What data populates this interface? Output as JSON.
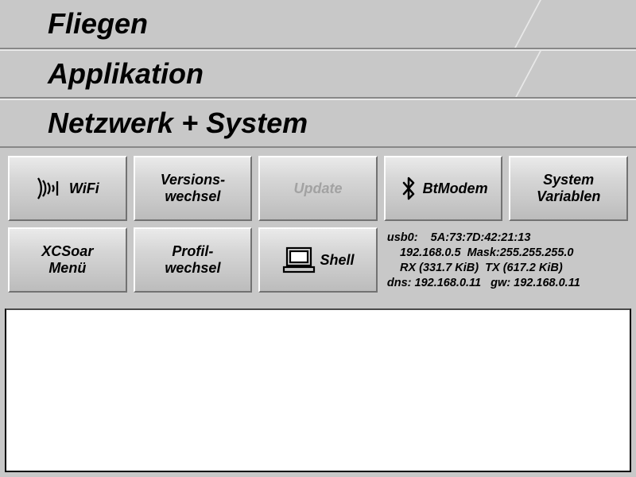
{
  "headers": {
    "fliegen": "Fliegen",
    "applikation": "Applikation",
    "netzwerk": "Netzwerk + System"
  },
  "buttons": {
    "wifi": "WiFi",
    "version_switch": "Versions-\nwechsel",
    "update": "Update",
    "btmodem": "BtModem",
    "sysvars": "System\nVariablen",
    "xcsoar_menu": "XCSoar\nMenü",
    "profile_switch": "Profil-\nwechsel",
    "shell": "Shell"
  },
  "network": {
    "iface_mac": "usb0:    5A:73:7D:42:21:13",
    "ip_mask": "    192.168.0.5  Mask:255.255.255.0",
    "rxtx": "    RX (331.7 KiB)  TX (617.2 KiB)",
    "dnsgw": "dns: 192.168.0.11   gw: 192.168.0.11"
  }
}
